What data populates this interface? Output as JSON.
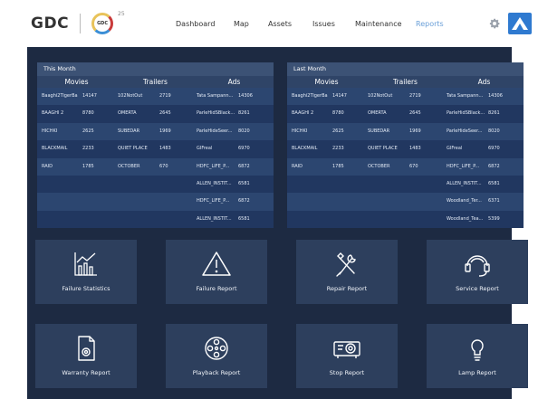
{
  "header": {
    "logo": "GDC",
    "badge": "GDC",
    "badge_sup": "25",
    "nav": [
      "Dashboard",
      "Map",
      "Assets",
      "Issues",
      "Maintenance",
      "Reports"
    ],
    "active_nav": "Reports"
  },
  "colors": {
    "dashboard_bg": "#1d2a42",
    "panel_bg": "#233454",
    "tile_bg": "#2d3f5d",
    "active_nav": "#6a9fd8",
    "brand": "#2f7ad0"
  },
  "this_month": {
    "title": "This Month",
    "headers": [
      "Movies",
      "Trailers",
      "Ads"
    ],
    "rows": [
      [
        "Baaghi2TigerBa",
        "14147",
        "102NotOut",
        "2719",
        "Tata Sampann...",
        "14306"
      ],
      [
        "BAAGHI 2",
        "8780",
        "OMERTA",
        "2645",
        "ParleHidSBlack...",
        "8261"
      ],
      [
        "HICHKI",
        "2625",
        "SUBEDAR",
        "1969",
        "ParleHideSeer...",
        "8020"
      ],
      [
        "BLACKMAIL",
        "2233",
        "QUIET PLACE",
        "1483",
        "GIFreal",
        "6970"
      ],
      [
        "RAID",
        "1785",
        "OCTOBER",
        "670",
        "HDFC_LIFE_P...",
        "6872"
      ],
      [
        "",
        "",
        "",
        "",
        "ALLEN_INSTIT...",
        "6581"
      ],
      [
        "",
        "",
        "",
        "",
        "HDFC_LIFE_P...",
        "6872"
      ],
      [
        "",
        "",
        "",
        "",
        "ALLEN_INSTIT...",
        "6581"
      ]
    ]
  },
  "last_month": {
    "title": "Last Month",
    "headers": [
      "Movies",
      "Trailers",
      "Ads"
    ],
    "rows": [
      [
        "Baaghi2TigerBa",
        "14147",
        "102NotOut",
        "2719",
        "Tata Sampann...",
        "14306"
      ],
      [
        "BAAGHI 2",
        "8780",
        "OMERTA",
        "2645",
        "ParleHidSBlack...",
        "8261"
      ],
      [
        "HICHKI",
        "2625",
        "SUBEDAR",
        "1969",
        "ParleHideSeer...",
        "8020"
      ],
      [
        "BLACKMAIL",
        "2233",
        "QUIET PLACE",
        "1483",
        "GIFreal",
        "6970"
      ],
      [
        "RAID",
        "1785",
        "OCTOBER",
        "670",
        "HDFC_LIFE_P...",
        "6872"
      ],
      [
        "",
        "",
        "",
        "",
        "ALLEN_INSTIT...",
        "6581"
      ],
      [
        "",
        "",
        "",
        "",
        "Woodland_Ter...",
        "6371"
      ],
      [
        "",
        "",
        "",
        "",
        "Woodland_Tea...",
        "5399"
      ]
    ]
  },
  "reports": [
    {
      "label": "Failure Statistics",
      "icon": "bar-chart-icon"
    },
    {
      "label": "Failure Report",
      "icon": "warning-icon"
    },
    {
      "label": "Repair Report",
      "icon": "tools-icon"
    },
    {
      "label": "Service Report",
      "icon": "headset-icon"
    },
    {
      "label": "Warranty Report",
      "icon": "warranty-document-icon"
    },
    {
      "label": "Playback Report",
      "icon": "film-reel-icon"
    },
    {
      "label": "Stop Report",
      "icon": "projector-icon"
    },
    {
      "label": "Lamp Report",
      "icon": "lamp-icon"
    }
  ]
}
